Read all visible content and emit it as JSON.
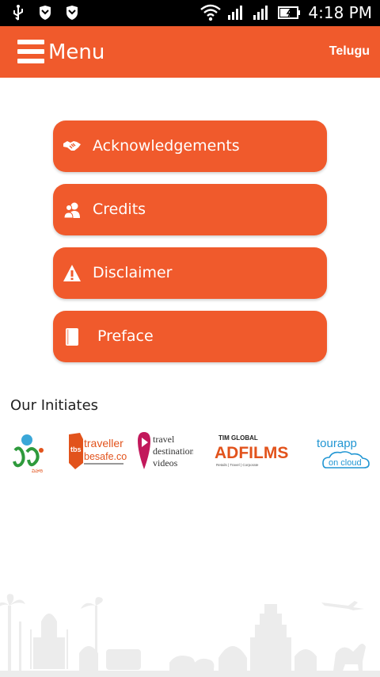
{
  "status_bar": {
    "time": "4:18 PM"
  },
  "header": {
    "menu_label": "Menu",
    "language": "Telugu"
  },
  "menu_items": [
    {
      "label": "Acknowledgements",
      "icon": "handshake-icon"
    },
    {
      "label": "Credits",
      "icon": "users-icon"
    },
    {
      "label": "Disclaimer",
      "icon": "warning-icon"
    },
    {
      "label": "Preface",
      "icon": "book-icon"
    }
  ],
  "initiates": {
    "title": "Our Initiates",
    "logos": [
      {
        "name": "vihari-logo",
        "sub": "విహారి"
      },
      {
        "name": "traveller-besafe-logo",
        "line1": "traveller",
        "line2": "besafe.com",
        "badge": "tbs"
      },
      {
        "name": "travel-destination-videos-logo",
        "line1": "travel",
        "line2": "destination",
        "line3": "videos"
      },
      {
        "name": "tim-global-adfilms-logo",
        "line1": "TIM GLOBAL",
        "line2": "ADFILMS",
        "line3": "Retails | Travel | Corporate"
      },
      {
        "name": "tourapp-on-cloud-logo",
        "line1": "tourapp",
        "line2": "on cloud"
      }
    ]
  },
  "colors": {
    "accent": "#f05a2c",
    "status_bar": "#000000",
    "skyline": "#ececec"
  }
}
